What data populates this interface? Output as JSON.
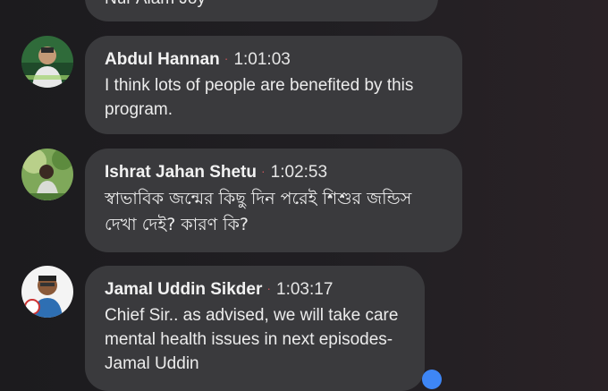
{
  "comments": [
    {
      "author": "",
      "timestamp": "",
      "text": "Nur Alam Joy"
    },
    {
      "author": "Abdul Hannan",
      "timestamp": "1:01:03",
      "text": "I think lots of people are benefited by this program."
    },
    {
      "author": "Ishrat Jahan Shetu",
      "timestamp": "1:02:53",
      "text": "স্বাভাবিক জন্মের কিছু দিন পরেই শিশুর জন্ডিস দেখা দেই? কারণ কি?"
    },
    {
      "author": "Jamal Uddin Sikder",
      "timestamp": "1:03:17",
      "text": "Chief Sir.. as advised, we will take care mental health issues in next episodes- Jamal Uddin"
    }
  ],
  "separator": "·",
  "colors": {
    "bubble": "#3a3a3d",
    "separator_dot": "#c25357",
    "reaction": "#3e86f5"
  }
}
